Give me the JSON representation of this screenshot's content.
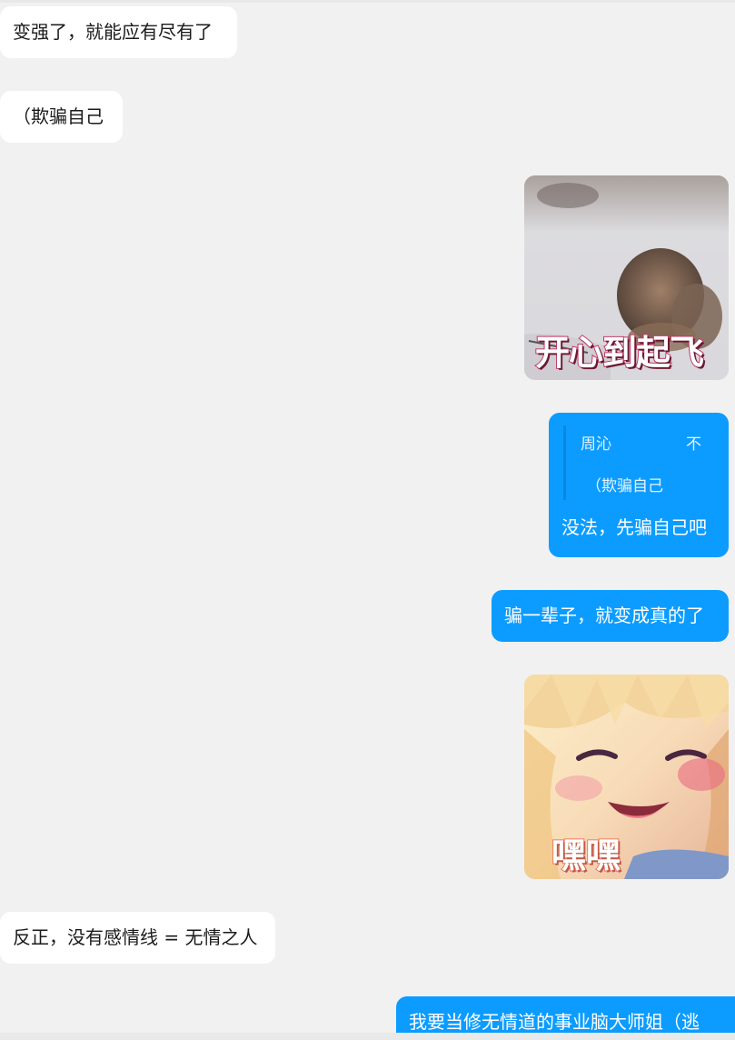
{
  "messages": {
    "m1": "变强了，就能应有尽有了",
    "m2": "（欺骗自己",
    "sticker1_caption": "开心到起飞",
    "reply": {
      "quoted_name": "周沁",
      "quoted_icon": "不",
      "quoted_text": "（欺骗自己",
      "text": "没法，先骗自己吧"
    },
    "m3": "骗一辈子，就变成真的了",
    "sticker2_caption": "嘿嘿",
    "m4": "反正，没有感情线 = 无情之人",
    "m5": "我要当修无情道的事业脑大师姐（逃"
  },
  "colors": {
    "background": "#f1f1f1",
    "incoming_bubble": "#ffffff",
    "outgoing_bubble": "#0c9cff"
  }
}
